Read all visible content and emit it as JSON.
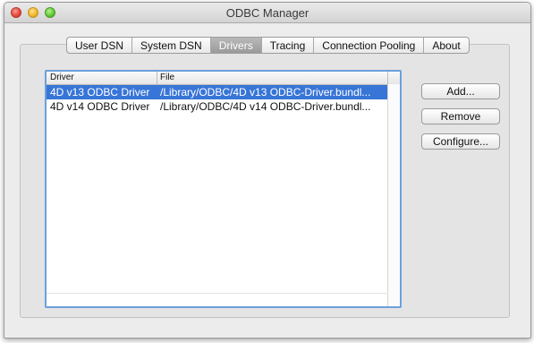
{
  "window": {
    "title": "ODBC Manager"
  },
  "tabs": [
    {
      "label": "User DSN"
    },
    {
      "label": "System DSN"
    },
    {
      "label": "Drivers"
    },
    {
      "label": "Tracing"
    },
    {
      "label": "Connection Pooling"
    },
    {
      "label": "About"
    }
  ],
  "active_tab": "Drivers",
  "table": {
    "columns": [
      {
        "label": "Driver"
      },
      {
        "label": "File"
      }
    ],
    "rows": [
      {
        "driver": "4D v13 ODBC Driver",
        "file": "/Library/ODBC/4D v13 ODBC-Driver.bundl...",
        "selected": true
      },
      {
        "driver": "4D v14 ODBC Driver",
        "file": "/Library/ODBC/4D v14 ODBC-Driver.bundl...",
        "selected": false
      }
    ]
  },
  "buttons": {
    "add": "Add...",
    "remove": "Remove",
    "configure": "Configure..."
  },
  "colors": {
    "selection": "#3875d7",
    "focus_ring": "#6aa0dd",
    "active_tab": "#9a9a9a"
  }
}
